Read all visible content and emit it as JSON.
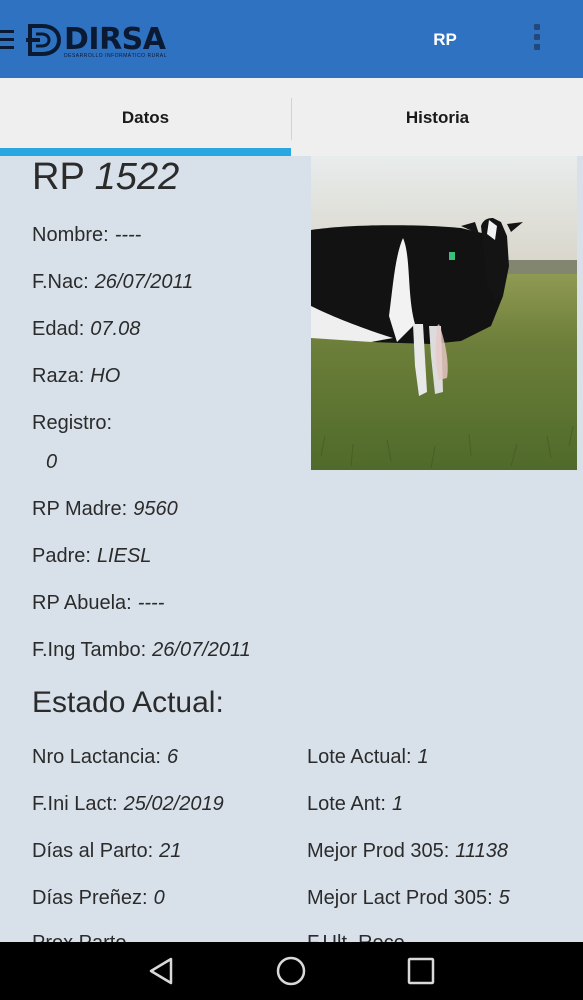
{
  "appbar": {
    "logo_text": "DIRSA",
    "logo_subtitle": "DESARROLLO INFORMÁTICO RURAL",
    "title": "RP",
    "icons": {
      "menu": "menu-icon",
      "more": "more-vert-icon"
    },
    "color": "#2f72c2"
  },
  "tabs": [
    {
      "label": "Datos",
      "active": true
    },
    {
      "label": "Historia",
      "active": false
    }
  ],
  "animal": {
    "rp_label": "RP",
    "rp_number": "1522",
    "photo": "holstein-cow-in-pasture",
    "fields": [
      {
        "label": "Nombre:",
        "value": "----"
      },
      {
        "label": "F.Nac:",
        "value": "26/07/2011"
      },
      {
        "label": "Edad:",
        "value": "07.08"
      },
      {
        "label": "Raza:",
        "value": "HO"
      },
      {
        "label": "Registro:",
        "value": "0"
      },
      {
        "label": "RP Madre:",
        "value": "9560"
      },
      {
        "label": "Padre:",
        "value": "LIESL"
      },
      {
        "label": "RP Abuela:",
        "value": "----"
      },
      {
        "label": "F.Ing Tambo:",
        "value": "26/07/2011"
      }
    ]
  },
  "estado": {
    "title": "Estado Actual:",
    "left": [
      {
        "label": "Nro Lactancia:",
        "value": "6"
      },
      {
        "label": "F.Ini Lact:",
        "value": "25/02/2019"
      },
      {
        "label": "Días al Parto:",
        "value": "21"
      },
      {
        "label": "Días Preñez:",
        "value": "0"
      },
      {
        "label": "Prox Parto",
        "value": ""
      }
    ],
    "right": [
      {
        "label": "Lote Actual:",
        "value": "1"
      },
      {
        "label": "Lote Ant:",
        "value": "1"
      },
      {
        "label": "Mejor Prod 305:",
        "value": "11138"
      },
      {
        "label": "Mejor Lact Prod 305:",
        "value": "5"
      },
      {
        "label": "F.Ult. Rece",
        "value": ""
      }
    ]
  },
  "navbar": {
    "icons": [
      "back-icon",
      "home-icon",
      "recents-icon"
    ]
  }
}
